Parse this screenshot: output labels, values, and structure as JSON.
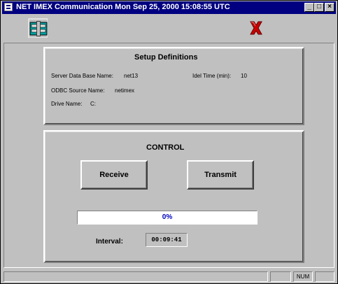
{
  "window": {
    "title": "NET IMEX Communication    Mon Sep 25, 2000    15:08:55 UTC",
    "controls": {
      "minimize": "_",
      "maximize": "□",
      "close": "×"
    }
  },
  "toolbar": {
    "settings_icon": "setup-icon",
    "exit_icon": "red-x-icon"
  },
  "setup": {
    "heading": "Setup Definitions",
    "server_db_label": "Server Data Base Name:",
    "server_db_value": "net13",
    "idle_label": "Idel Time (min):",
    "idle_value": "10",
    "odbc_label": "ODBC Source Name:",
    "odbc_value": "netimex",
    "drive_label": "Drive Name:",
    "drive_value": "C:"
  },
  "control": {
    "heading": "CONTROL",
    "receive_label": "Receive",
    "transmit_label": "Transmit",
    "progress_text": "0%",
    "progress_value": 0,
    "interval_label": "Interval:",
    "interval_value": "00:09:41"
  },
  "statusbar": {
    "num_indicator": "NUM"
  },
  "colors": {
    "titlebar": "#000080",
    "face": "#c0c0c0",
    "progress_text": "#0000c0",
    "exit_red": "#cc0000"
  }
}
